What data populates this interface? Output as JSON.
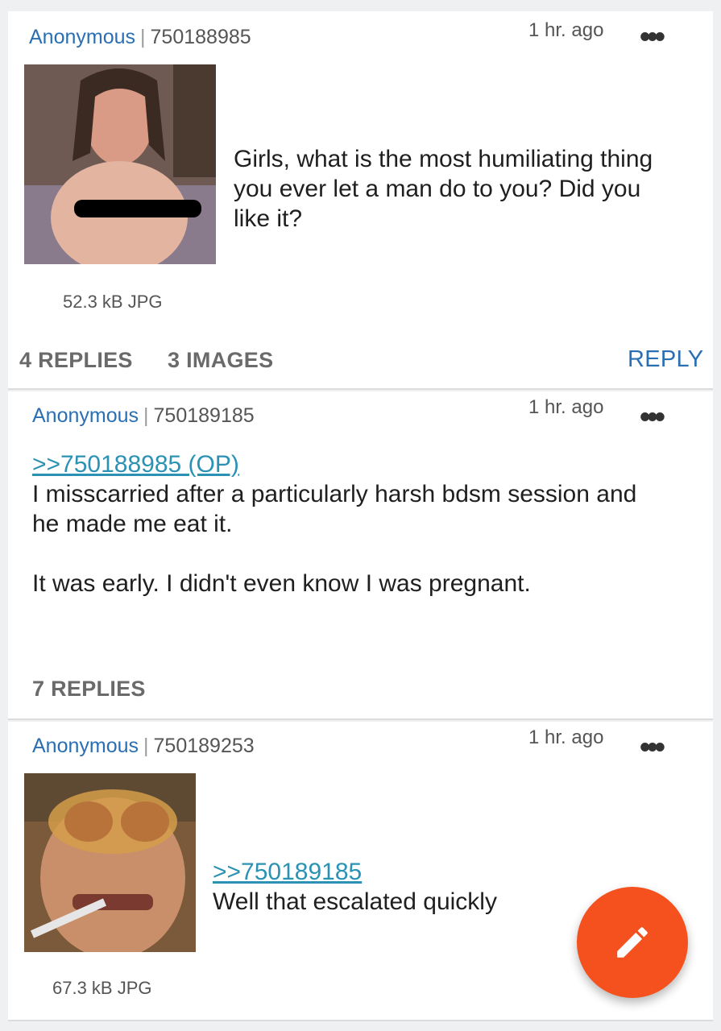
{
  "posts": [
    {
      "name": "Anonymous",
      "separator": "|",
      "post_id": "750188985",
      "time": "1 hr. ago",
      "image": {
        "icon": "photo-thumbnail",
        "file_info": "52.3 kB JPG"
      },
      "text_lines": [
        "Girls, what is the most humiliating thing",
        "you ever let a man do to you? Did you",
        "like it?"
      ],
      "actions": {
        "replies": "4 REPLIES",
        "images": "3 IMAGES",
        "reply": "REPLY"
      }
    },
    {
      "name": "Anonymous",
      "separator": "|",
      "post_id": "750189185",
      "time": "1 hr. ago",
      "quote_link": ">>750188985 (OP)",
      "text_lines": [
        "I misscarried after a particularly harsh bdsm session and",
        "he made me eat it.",
        "",
        "It was early. I didn't even know I was pregnant."
      ],
      "actions": {
        "replies": "7 REPLIES"
      }
    },
    {
      "name": "Anonymous",
      "separator": "|",
      "post_id": "750189253",
      "time": "1 hr. ago",
      "image": {
        "icon": "photo-thumbnail",
        "file_info": "67.3 kB JPG"
      },
      "quote_link": ">>750189185",
      "text_lines": [
        "Well that escalated quickly"
      ]
    }
  ],
  "fab": {
    "icon": "pencil-icon",
    "accent": "#f4511e"
  },
  "colors": {
    "name": "#2a6fb4",
    "link": "#2b92b4",
    "background": "#eef0f1"
  }
}
